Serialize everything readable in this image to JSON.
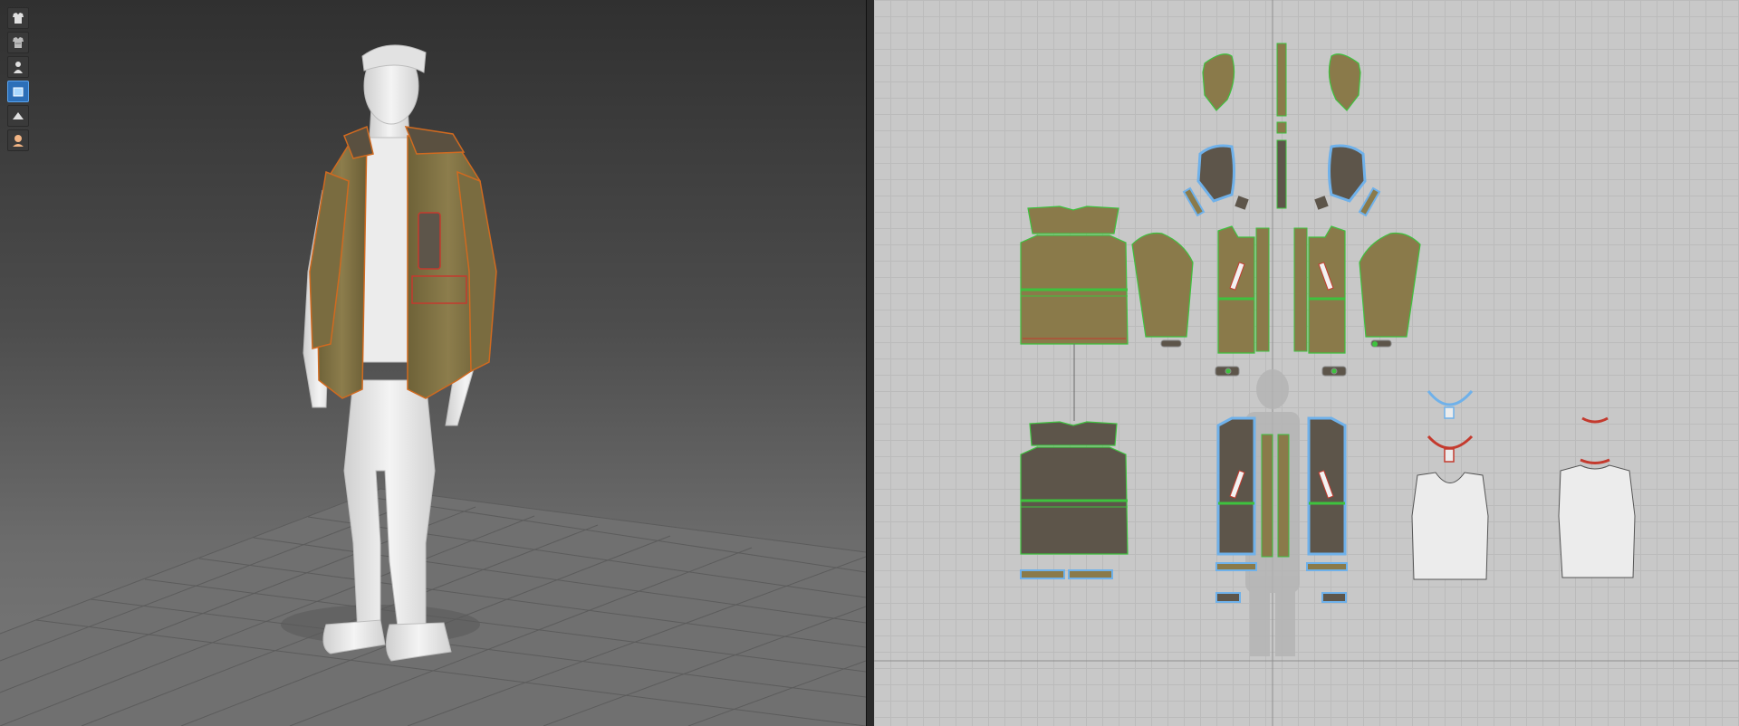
{
  "app": {
    "windows": [
      "3d-garment-window",
      "2d-pattern-window"
    ]
  },
  "toolbar_3d": {
    "tools": [
      {
        "icon": "garment-show-icon",
        "active": false
      },
      {
        "icon": "garment-texture-icon",
        "active": false
      },
      {
        "icon": "avatar-show-icon",
        "active": false
      },
      {
        "icon": "fabric-display-icon",
        "active": true
      },
      {
        "icon": "arrangement-icon",
        "active": false
      },
      {
        "icon": "avatar-skin-icon",
        "active": false
      }
    ]
  },
  "colors": {
    "jacket_fabric": "#8a7a4a",
    "lining_fabric": "#5d554a",
    "tshirt_fabric": "#ececec",
    "avatar_skin": "#ededed",
    "seam_line_green": "#3ec23e",
    "seam_line_red": "#c43a2e",
    "selection_blue": "#6fb1ea",
    "stitch_orange": "#d06a20"
  }
}
